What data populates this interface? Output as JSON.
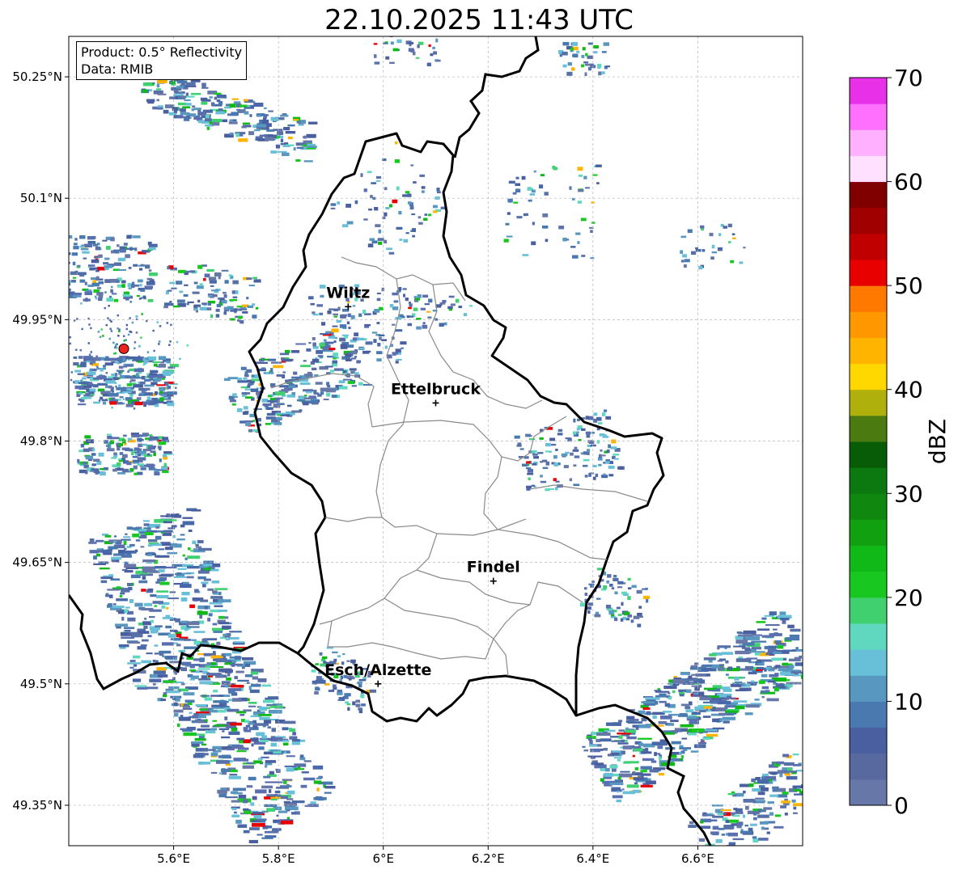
{
  "title": "22.10.2025 11:43 UTC",
  "info_box": {
    "product": "Product: 0.5° Reflectivity",
    "data": "Data: RMIB"
  },
  "axes": {
    "x_ticks": [
      "5.6°E",
      "5.8°E",
      "6°E",
      "6.2°E",
      "6.4°E",
      "6.6°E"
    ],
    "y_ticks": [
      "50.25°N",
      "50.1°N",
      "49.95°N",
      "49.8°N",
      "49.65°N",
      "49.5°N",
      "49.35°N"
    ],
    "lon_range": [
      5.4,
      6.8
    ],
    "lat_range": [
      49.3,
      50.3
    ],
    "grid": "on"
  },
  "cities": [
    {
      "name": "Wiltz",
      "lon": 5.933,
      "lat": 49.966
    },
    {
      "name": "Ettelbruck",
      "lon": 6.1,
      "lat": 49.847
    },
    {
      "name": "Findel",
      "lon": 6.21,
      "lat": 49.627
    },
    {
      "name": "Esch/Alzette",
      "lon": 5.99,
      "lat": 49.5
    }
  ],
  "radar_site": {
    "lon": 5.505,
    "lat": 49.914,
    "color": "#e8251f"
  },
  "colorbar": {
    "label": "dBZ",
    "ticks": [
      "0",
      "10",
      "20",
      "30",
      "40",
      "50",
      "60",
      "70"
    ],
    "range": [
      0,
      70
    ],
    "colors": [
      "#6677a8",
      "#5869a0",
      "#4a5fa0",
      "#4a79b0",
      "#5898c0",
      "#68c0d8",
      "#60d8c0",
      "#40d070",
      "#18c820",
      "#10b818",
      "#10a010",
      "#108810",
      "#0c7810",
      "#085c08",
      "#4a7a10",
      "#b0b00c",
      "#ffd800",
      "#ffb400",
      "#ff9800",
      "#ff7800",
      "#e80000",
      "#c00000",
      "#a00000",
      "#800000",
      "#ffe0ff",
      "#ffb0ff",
      "#ff70ff",
      "#e830e8"
    ]
  }
}
